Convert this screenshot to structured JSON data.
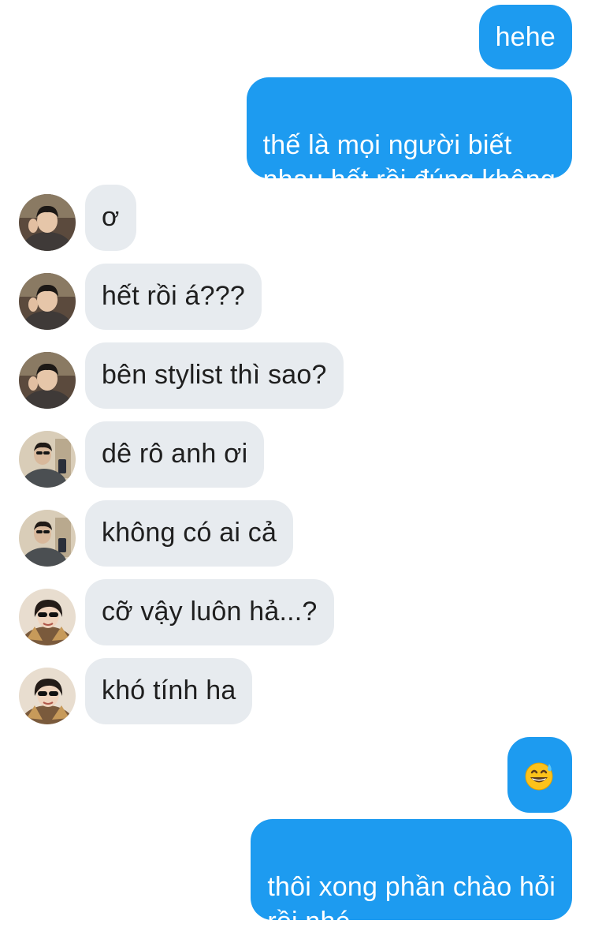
{
  "messages": [
    {
      "side": "out",
      "text": "hehe"
    },
    {
      "side": "out",
      "text": "thế là mọi người biết\nnhau hết rồi đúng không"
    },
    {
      "side": "in",
      "avatar": "avatar-boy-a",
      "text": "ơ"
    },
    {
      "side": "in",
      "avatar": "avatar-boy-a",
      "text": "hết rồi á???"
    },
    {
      "side": "in",
      "avatar": "avatar-boy-a",
      "text": "bên stylist thì sao?"
    },
    {
      "side": "in",
      "avatar": "avatar-boy-b",
      "text": "dê rô anh ơi"
    },
    {
      "side": "in",
      "avatar": "avatar-boy-b",
      "text": "không có ai cả"
    },
    {
      "side": "in",
      "avatar": "avatar-girl-sunglasses",
      "text": "cỡ vậy luôn hả...?"
    },
    {
      "side": "in",
      "avatar": "avatar-girl-sunglasses",
      "text": "khó tính ha"
    },
    {
      "side": "out",
      "emoji": "grinning-sweat-emoji"
    },
    {
      "side": "out",
      "text": "thôi xong phần chào hỏi\nrồi nhé"
    }
  ],
  "colors": {
    "outgoing_bubble": "#1d9bf0",
    "incoming_bubble": "#e7ebef",
    "outgoing_text": "#ffffff",
    "incoming_text": "#1f1f1f"
  }
}
